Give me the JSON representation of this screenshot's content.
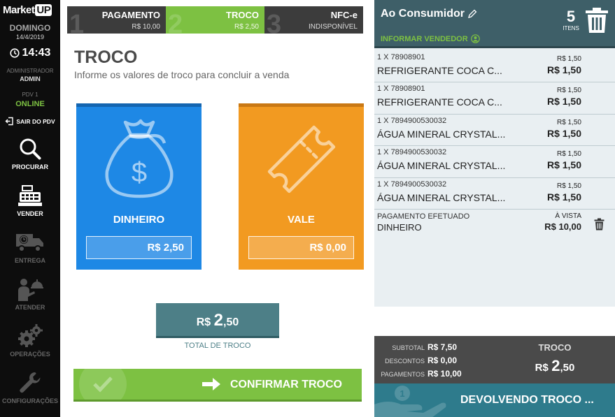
{
  "sidebar": {
    "logo_main": "Market",
    "logo_up": "UP",
    "day": "DOMINGO",
    "date": "14/4/2019",
    "time": "14:43",
    "user_role": "ADMINISTRADOR",
    "user_name": "ADMIN",
    "pdv_label": "PDV 1",
    "pdv_status": "ONLINE",
    "logout_label": "SAIR DO PDV",
    "nav": [
      {
        "label": "PROCURAR",
        "icon": "search-icon"
      },
      {
        "label": "VENDER",
        "icon": "cash-register-icon"
      },
      {
        "label": "ENTREGA",
        "icon": "delivery-truck-icon"
      },
      {
        "label": "ATENDER",
        "icon": "waiter-icon"
      },
      {
        "label": "OPERAÇÕES",
        "icon": "gears-icon"
      },
      {
        "label": "CONFIGURAÇÕES",
        "icon": "wrench-icon"
      }
    ]
  },
  "steps": [
    {
      "num": "1",
      "title": "PAGAMENTO",
      "sub": "R$ 10,00",
      "active": false
    },
    {
      "num": "2",
      "title": "TROCO",
      "sub": "R$ 2,50",
      "active": true
    },
    {
      "num": "3",
      "title": "NFC-e",
      "sub": "INDISPONÍVEL",
      "active": false
    }
  ],
  "troco": {
    "title": "TROCO",
    "subtitle": "Informe os valores de troco para concluir a venda",
    "cards": {
      "dinheiro": {
        "label": "DINHEIRO",
        "value": "R$ 2,50"
      },
      "vale": {
        "label": "VALE",
        "value": "R$ 0,00"
      }
    },
    "total": {
      "currency": "R$",
      "int": "2",
      "dec": ",50",
      "label": "TOTAL DE TROCO"
    },
    "confirm_label": "CONFIRMAR TROCO"
  },
  "customer": {
    "name": "Ao Consumidor",
    "vendor_link": "INFORMAR VENDEDOR",
    "item_count": "5",
    "item_count_label": "ITENS"
  },
  "items": [
    {
      "code": "1 X 78908901",
      "desc": "REFRIGERANTE COCA C...",
      "unit": "R$ 1,50",
      "total": "R$ 1,50"
    },
    {
      "code": "1 X 78908901",
      "desc": "REFRIGERANTE COCA C...",
      "unit": "R$ 1,50",
      "total": "R$ 1,50"
    },
    {
      "code": "1 X 7894900530032",
      "desc": "ÁGUA MINERAL CRYSTAL...",
      "unit": "R$ 1,50",
      "total": "R$ 1,50"
    },
    {
      "code": "1 X 7894900530032",
      "desc": "ÁGUA MINERAL CRYSTAL...",
      "unit": "R$ 1,50",
      "total": "R$ 1,50"
    },
    {
      "code": "1 X 7894900530032",
      "desc": "ÁGUA MINERAL CRYSTAL...",
      "unit": "R$ 1,50",
      "total": "R$ 1,50"
    }
  ],
  "payment": {
    "label": "PAGAMENTO EFETUADO",
    "method": "DINHEIRO",
    "type": "À VISTA",
    "amount": "R$ 10,00"
  },
  "summary": {
    "subtotal_label": "SUBTOTAL",
    "subtotal": "R$ 7,50",
    "descontos_label": "DESCONTOS",
    "descontos": "R$ 0,00",
    "pagamentos_label": "PAGAMENTOS",
    "pagamentos": "R$ 10,00",
    "troco_label": "TROCO",
    "troco_currency": "R$",
    "troco_int": "2",
    "troco_dec": ",50"
  },
  "devolvendo_label": "DEVOLVENDO TROCO ...",
  "colors": {
    "green": "#7dc142",
    "blue": "#1e88e5",
    "orange": "#f29a21",
    "teal": "#4d7f87",
    "sidebar_bg": "#0d0d0d"
  }
}
